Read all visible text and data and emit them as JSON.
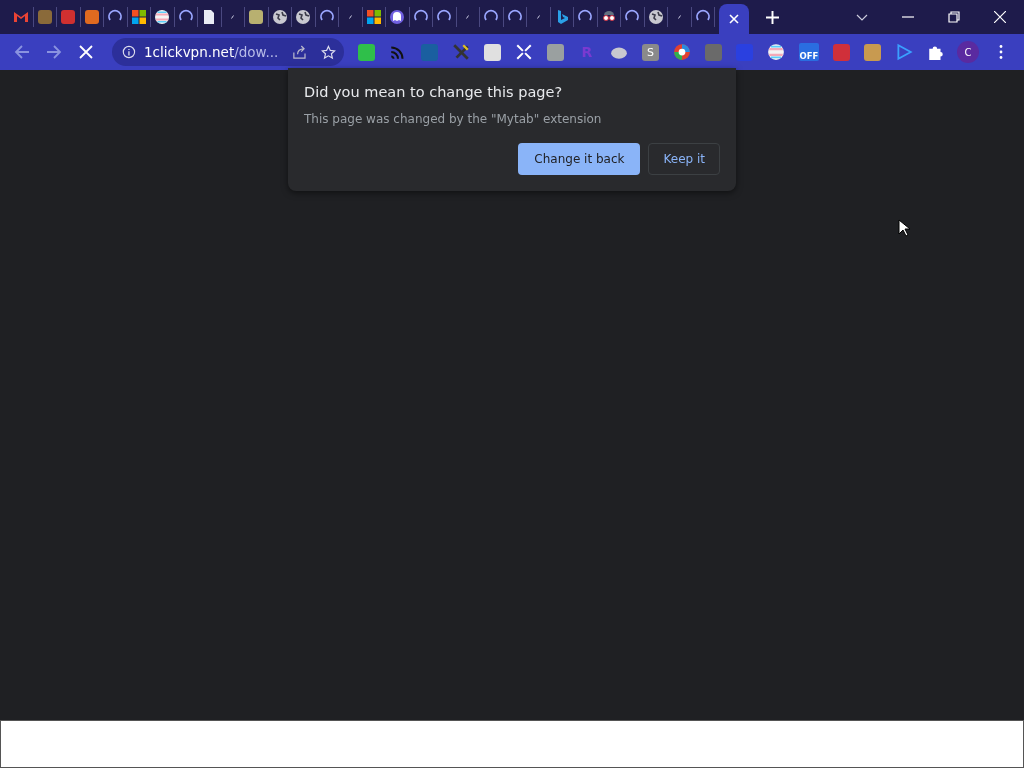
{
  "tabs": [
    {
      "kind": "mail",
      "selected": false
    },
    {
      "kind": "tile",
      "color": "#8a6a3a",
      "selected": false
    },
    {
      "kind": "tile",
      "color": "#d03030",
      "selected": false
    },
    {
      "kind": "tile",
      "color": "#e06a20",
      "selected": false
    },
    {
      "kind": "spinner",
      "selected": false
    },
    {
      "kind": "windows",
      "selected": false
    },
    {
      "kind": "stripes",
      "selected": false
    },
    {
      "kind": "spinner",
      "selected": false
    },
    {
      "kind": "doc",
      "selected": false
    },
    {
      "kind": "dot",
      "selected": false
    },
    {
      "kind": "tile",
      "color": "#b8b070",
      "selected": false
    },
    {
      "kind": "globe",
      "selected": false
    },
    {
      "kind": "globe",
      "selected": false
    },
    {
      "kind": "spinner",
      "selected": false
    },
    {
      "kind": "dot",
      "selected": false
    },
    {
      "kind": "windows",
      "selected": false
    },
    {
      "kind": "ghost",
      "selected": false
    },
    {
      "kind": "spinner",
      "selected": false
    },
    {
      "kind": "spinner",
      "selected": false
    },
    {
      "kind": "dot",
      "selected": false
    },
    {
      "kind": "spinner",
      "selected": false
    },
    {
      "kind": "spinner",
      "selected": false
    },
    {
      "kind": "dot",
      "selected": false
    },
    {
      "kind": "bing",
      "selected": false
    },
    {
      "kind": "spinner",
      "selected": false
    },
    {
      "kind": "glasses",
      "selected": false
    },
    {
      "kind": "spinner",
      "selected": false
    },
    {
      "kind": "globe",
      "selected": false
    },
    {
      "kind": "dot",
      "selected": false
    },
    {
      "kind": "spinner",
      "selected": false
    },
    {
      "kind": "none",
      "selected": true
    }
  ],
  "address": {
    "domain": "1clickvpn.net",
    "path": "/dow..."
  },
  "loading": true,
  "extensions": [
    {
      "kind": "tile",
      "color": "#2fbf4a"
    },
    {
      "kind": "feed"
    },
    {
      "kind": "tile",
      "color": "#1a5fa0"
    },
    {
      "kind": "tools"
    },
    {
      "kind": "tile",
      "color": "#e0e0e0"
    },
    {
      "kind": "cross"
    },
    {
      "kind": "tile",
      "color": "#9aa0a0"
    },
    {
      "kind": "letter",
      "label": "R",
      "color": "#7a3ad0"
    },
    {
      "kind": "cloud"
    },
    {
      "kind": "tile",
      "color": "#8a8a8a",
      "label": "S"
    },
    {
      "kind": "edge"
    },
    {
      "kind": "tile",
      "color": "#6a6a6a"
    },
    {
      "kind": "tile",
      "color": "#2a40e0"
    },
    {
      "kind": "stripes"
    },
    {
      "kind": "badge",
      "label": "OFF"
    },
    {
      "kind": "tile",
      "color": "#d0303a"
    },
    {
      "kind": "tile",
      "color": "#c89a50"
    },
    {
      "kind": "play"
    },
    {
      "kind": "puzzle"
    }
  ],
  "profile": {
    "initial": "C"
  },
  "dialog": {
    "title": "Did you mean to change this page?",
    "message": "This page was changed by the \"Mytab\" extension",
    "primary": "Change it back",
    "secondary": "Keep it"
  }
}
